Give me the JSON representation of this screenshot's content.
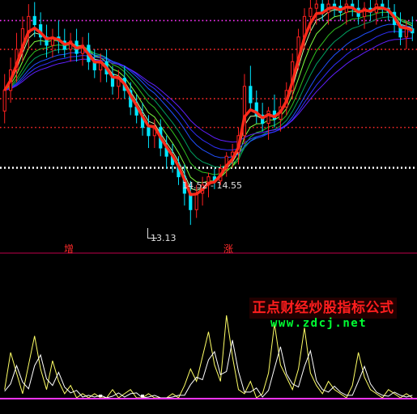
{
  "labels": {
    "range": "14.52 - 14.55",
    "low": "13.13",
    "zeng": "增",
    "zhang": "涨"
  },
  "watermark": {
    "title": "正点财经炒股指标公式",
    "url": "www.zdcj.net"
  },
  "colors": {
    "background": "#000000",
    "main_line": "#ff2a1a",
    "candle_up": "#ff2020",
    "candle_down": "#00e6ff",
    "level_magenta": "#ff33ff",
    "level_red": "#ff2a2a",
    "level_white": "#ffffff",
    "separator": "#c0004a",
    "indicator_line": "#ffff66",
    "indicator_line_2": "#ffffff",
    "indicator_base": "#ff33ff",
    "ribbon": [
      "#c8ffa0",
      "#80ff40",
      "#30c020",
      "#00a060",
      "#2050ff",
      "#3030ff",
      "#6020ff"
    ]
  },
  "chart_data": {
    "type": "candlestick",
    "panels": [
      "price",
      "indicator"
    ],
    "price_range": [
      12.7,
      18.6
    ],
    "indicator_range": [
      0,
      1
    ],
    "levels": [
      {
        "name": "level-top",
        "value": 18.1,
        "style": "dotted",
        "color": "magenta"
      },
      {
        "name": "level-upper",
        "value": 17.4,
        "style": "dotted",
        "color": "red"
      },
      {
        "name": "level-mid",
        "value": 16.2,
        "style": "dotted",
        "color": "red"
      },
      {
        "name": "level-low",
        "value": 15.5,
        "style": "dotted",
        "color": "red"
      },
      {
        "name": "level-white",
        "value": 14.52,
        "style": "dotted",
        "color": "white"
      }
    ],
    "annotations": [
      {
        "text": "14.52 - 14.55",
        "at_bar": 39,
        "value": 14.53
      },
      {
        "text": "13.13",
        "at_bar": 31,
        "value": 13.13
      }
    ],
    "candles": [
      [
        15.9,
        16.8,
        15.6,
        16.4
      ],
      [
        16.4,
        17.2,
        16.1,
        16.9
      ],
      [
        16.9,
        17.8,
        16.6,
        17.4
      ],
      [
        17.4,
        18.2,
        17.1,
        17.9
      ],
      [
        17.8,
        18.5,
        17.4,
        18.2
      ],
      [
        18.2,
        18.55,
        17.7,
        18.0
      ],
      [
        18.0,
        18.3,
        17.5,
        17.7
      ],
      [
        17.7,
        18.0,
        17.2,
        17.5
      ],
      [
        17.5,
        17.9,
        17.2,
        17.7
      ],
      [
        17.7,
        18.1,
        17.3,
        17.6
      ],
      [
        17.6,
        17.9,
        17.2,
        17.4
      ],
      [
        17.4,
        17.8,
        17.1,
        17.6
      ],
      [
        17.6,
        17.9,
        17.1,
        17.3
      ],
      [
        17.3,
        17.7,
        17.0,
        17.5
      ],
      [
        17.5,
        17.8,
        16.9,
        17.1
      ],
      [
        17.1,
        17.4,
        16.7,
        16.9
      ],
      [
        16.9,
        17.3,
        16.6,
        17.1
      ],
      [
        17.1,
        17.4,
        16.6,
        16.8
      ],
      [
        16.8,
        17.0,
        16.3,
        16.5
      ],
      [
        16.5,
        16.9,
        16.2,
        16.7
      ],
      [
        16.7,
        17.0,
        16.2,
        16.4
      ],
      [
        16.4,
        16.6,
        15.8,
        16.0
      ],
      [
        16.0,
        16.3,
        15.6,
        15.8
      ],
      [
        15.8,
        16.1,
        15.3,
        15.5
      ],
      [
        15.5,
        15.8,
        15.0,
        15.3
      ],
      [
        15.3,
        15.7,
        15.0,
        15.5
      ],
      [
        15.5,
        15.7,
        14.8,
        15.0
      ],
      [
        15.0,
        15.3,
        14.5,
        14.8
      ],
      [
        14.8,
        15.1,
        14.4,
        14.6
      ],
      [
        14.6,
        14.8,
        14.1,
        14.3
      ],
      [
        14.3,
        14.6,
        13.6,
        13.9
      ],
      [
        13.9,
        14.2,
        13.13,
        13.5
      ],
      [
        13.5,
        14.1,
        13.3,
        13.9
      ],
      [
        13.9,
        14.3,
        13.6,
        14.1
      ],
      [
        14.1,
        14.4,
        13.8,
        14.3
      ],
      [
        14.3,
        14.5,
        14.0,
        14.2
      ],
      [
        14.2,
        14.6,
        14.1,
        14.5
      ],
      [
        14.5,
        14.9,
        14.3,
        14.8
      ],
      [
        14.8,
        15.1,
        14.52,
        14.9
      ],
      [
        14.9,
        15.5,
        14.6,
        15.3
      ],
      [
        15.3,
        16.8,
        15.1,
        16.5
      ],
      [
        16.5,
        17.0,
        15.9,
        16.1
      ],
      [
        16.1,
        16.4,
        15.6,
        15.8
      ],
      [
        15.8,
        16.1,
        15.4,
        15.6
      ],
      [
        15.6,
        16.0,
        15.2,
        15.9
      ],
      [
        15.9,
        16.3,
        15.5,
        15.7
      ],
      [
        15.7,
        16.2,
        15.4,
        16.0
      ],
      [
        16.0,
        16.6,
        15.8,
        16.4
      ],
      [
        16.4,
        17.3,
        16.2,
        17.1
      ],
      [
        17.1,
        17.9,
        16.9,
        17.7
      ],
      [
        17.7,
        18.4,
        17.4,
        18.2
      ],
      [
        18.2,
        18.6,
        17.8,
        18.4
      ],
      [
        18.4,
        18.6,
        18.0,
        18.5
      ],
      [
        18.5,
        18.6,
        18.1,
        18.3
      ],
      [
        18.3,
        18.6,
        18.0,
        18.5
      ],
      [
        18.5,
        18.6,
        18.2,
        18.45
      ],
      [
        18.45,
        18.6,
        18.1,
        18.3
      ],
      [
        18.3,
        18.6,
        18.0,
        18.5
      ],
      [
        18.5,
        18.6,
        18.2,
        18.4
      ],
      [
        18.4,
        18.6,
        18.0,
        18.2
      ],
      [
        18.2,
        18.55,
        17.9,
        18.4
      ],
      [
        18.4,
        18.6,
        18.1,
        18.3
      ],
      [
        18.3,
        18.6,
        18.0,
        18.5
      ],
      [
        18.5,
        18.6,
        18.2,
        18.4
      ],
      [
        18.4,
        18.6,
        18.1,
        18.3
      ],
      [
        18.3,
        18.5,
        17.8,
        18.0
      ],
      [
        18.0,
        18.3,
        17.5,
        17.7
      ],
      [
        17.7,
        18.1,
        17.4,
        17.9
      ],
      [
        17.9,
        18.2,
        17.6,
        17.8
      ]
    ],
    "indicator": [
      0.1,
      0.55,
      0.3,
      0.05,
      0.4,
      0.75,
      0.35,
      0.1,
      0.45,
      0.2,
      0.05,
      0.15,
      0.0,
      0.05,
      0.0,
      0.05,
      0.0,
      0.0,
      0.1,
      0.0,
      0.05,
      0.1,
      0.0,
      0.0,
      0.05,
      0.0,
      0.0,
      0.0,
      0.05,
      0.0,
      0.15,
      0.35,
      0.2,
      0.5,
      0.8,
      0.4,
      0.2,
      1.0,
      0.5,
      0.1,
      0.05,
      0.2,
      0.0,
      0.05,
      0.3,
      0.9,
      0.4,
      0.25,
      0.1,
      0.35,
      0.85,
      0.3,
      0.15,
      0.05,
      0.2,
      0.1,
      0.05,
      0.0,
      0.15,
      0.55,
      0.25,
      0.1,
      0.05,
      0.0,
      0.1,
      0.05,
      0.0,
      0.05,
      0.0
    ]
  }
}
